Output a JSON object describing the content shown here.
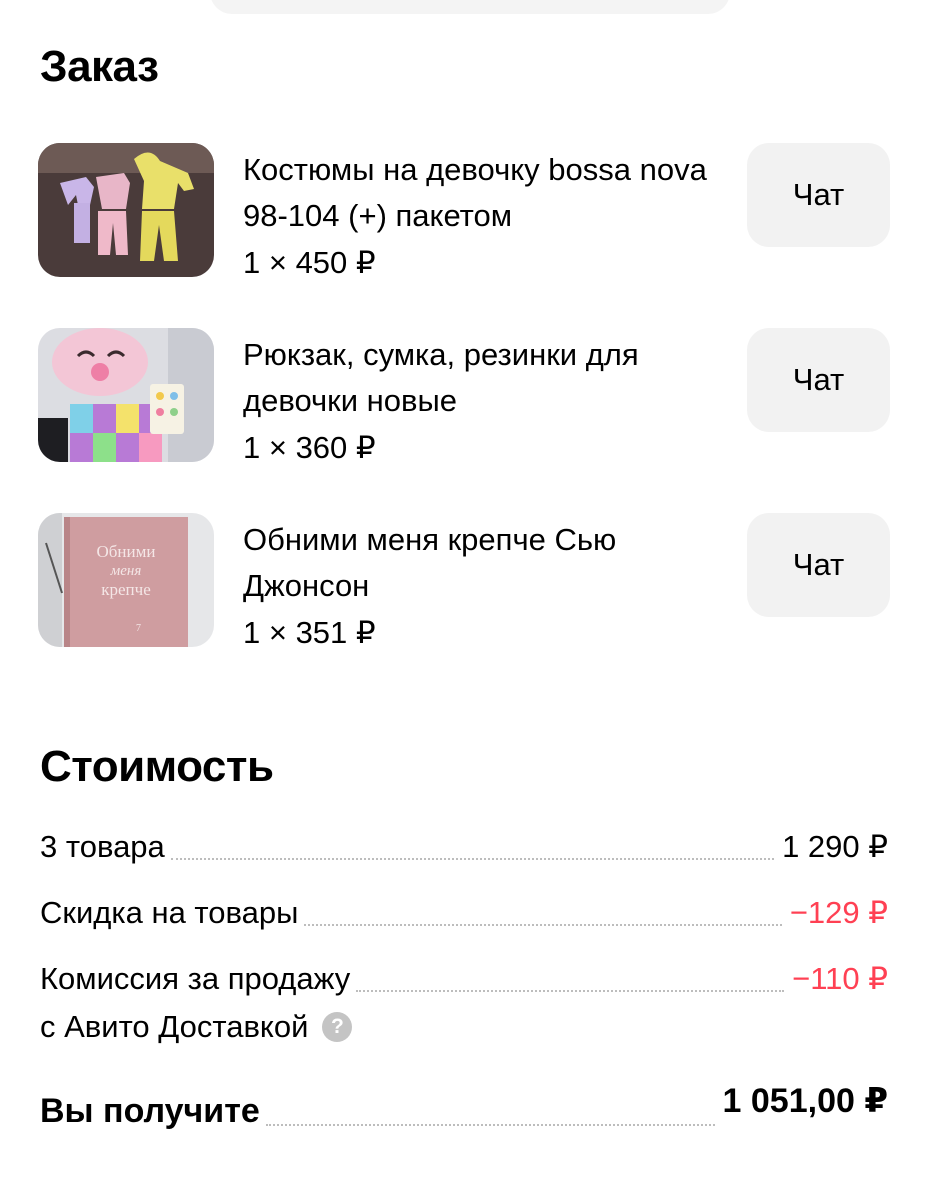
{
  "order": {
    "title": "Заказ",
    "items": [
      {
        "title": "Костюмы на девочку bossa nova 98-104 (+) пакетом",
        "price": "1 × 450 ₽",
        "chat_label": "Чат"
      },
      {
        "title": "Рюкзак, сумка, резинки для девочки новые",
        "price": "1 × 360 ₽",
        "chat_label": "Чат"
      },
      {
        "title": "Обними меня крепче Сью Джонсон",
        "price": "1 × 351 ₽",
        "chat_label": "Чат"
      }
    ],
    "book_cover_text": [
      "Обними",
      "меня",
      "крепче",
      "7"
    ]
  },
  "cost": {
    "title": "Стоимость",
    "goods_label": "3 товара",
    "goods_value": "1 290 ₽",
    "discount_label": "Скидка на товары",
    "discount_value": "−129 ₽",
    "commission_label": "Комиссия за продажу",
    "commission_label_line2": "с Авито Доставкой",
    "commission_value": "−110 ₽",
    "help_icon": "?",
    "total_label": "Вы получите",
    "total_value": "1 051,00 ₽",
    "negative_color": "#ff4053"
  }
}
